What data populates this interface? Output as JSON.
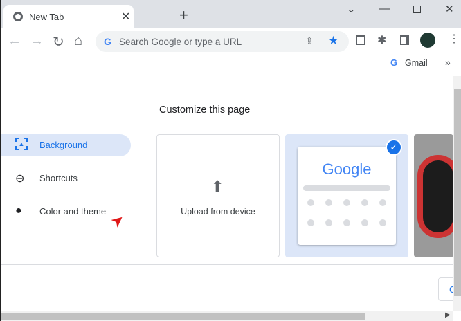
{
  "tab": {
    "title": "New Tab"
  },
  "omnibox": {
    "placeholder": "Search Google or type a URL"
  },
  "bookmarks": {
    "gmail": "Gmail",
    "more": "»"
  },
  "customize": {
    "title": "Customize this page",
    "nav": [
      {
        "label": "Background",
        "selected": true
      },
      {
        "label": "Shortcuts"
      },
      {
        "label": "Color and theme"
      }
    ],
    "upload_label": "Upload from device",
    "google_logo": "Google",
    "cancel_partial": "C"
  },
  "colors": {
    "accent": "#1a73e8",
    "selected_bg": "#e8f0fe"
  }
}
